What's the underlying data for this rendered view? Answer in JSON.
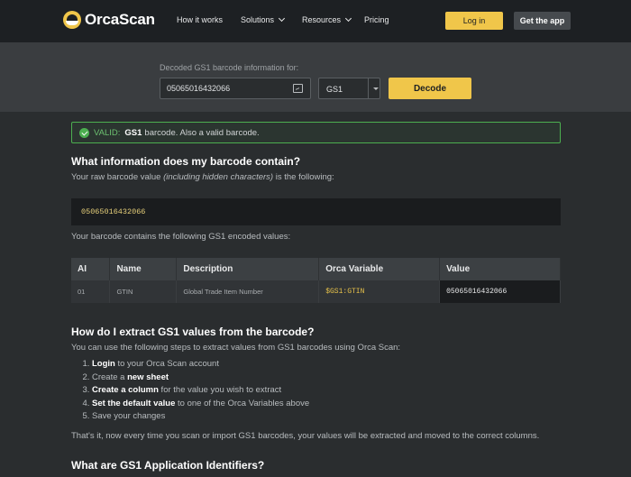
{
  "nav": {
    "logo_text": "OrcaScan",
    "links": [
      {
        "label": "How it works"
      },
      {
        "label": "Solutions"
      },
      {
        "label": "Resources"
      },
      {
        "label": "Pricing"
      }
    ],
    "login_label": "Log in",
    "get_app_label": "Get the app"
  },
  "hero": {
    "label": "Decoded GS1 barcode information for:",
    "barcode_value": "05065016432066",
    "select_value": "GS1",
    "decode_label": "Decode"
  },
  "valid": {
    "status": "VALID:",
    "type": "GS1",
    "message": "barcode. Also a valid barcode."
  },
  "section1": {
    "title": "What information does my barcode contain?",
    "intro_a": "Your raw barcode value ",
    "intro_em": "(including hidden characters)",
    "intro_b": " is the following:",
    "raw_value": "05065016432066",
    "encoded_intro": "Your barcode contains the following GS1 encoded values:"
  },
  "table": {
    "headers": [
      "AI",
      "Name",
      "Description",
      "Orca Variable",
      "Value"
    ],
    "rows": [
      {
        "ai": "01",
        "name": "GTIN",
        "description": "Global Trade Item Number",
        "variable": "$GS1:GTIN",
        "value": "05065016432066"
      }
    ]
  },
  "section2": {
    "title": "How do I extract GS1 values from the barcode?",
    "intro": "You can use the following steps to extract values from GS1 barcodes using Orca Scan:",
    "steps": [
      {
        "strong": "Login",
        "rest": " to your Orca Scan account",
        "pre": ""
      },
      {
        "pre": "Create a ",
        "strong": "new sheet",
        "rest": ""
      },
      {
        "pre": "",
        "strong": "Create a column",
        "rest": " for the value you wish to extract"
      },
      {
        "pre": "",
        "strong": "Set the default value",
        "rest": " to one of the Orca Variables above"
      },
      {
        "pre": "Save your changes",
        "strong": "",
        "rest": ""
      }
    ],
    "outro": "That's it, now every time you scan or import GS1 barcodes, your values will be extracted and moved to the correct columns."
  },
  "section3": {
    "title": "What are GS1 Application Identifiers?"
  },
  "colors": {
    "accent": "#f0c64a",
    "valid_green": "#4caf50",
    "background": "#2a2d2f",
    "nav_background": "#1d2023"
  },
  "icons": [
    "orca-logo-icon",
    "chevron-down-icon",
    "scan-image-icon",
    "select-caret-icon",
    "check-circle-icon"
  ]
}
